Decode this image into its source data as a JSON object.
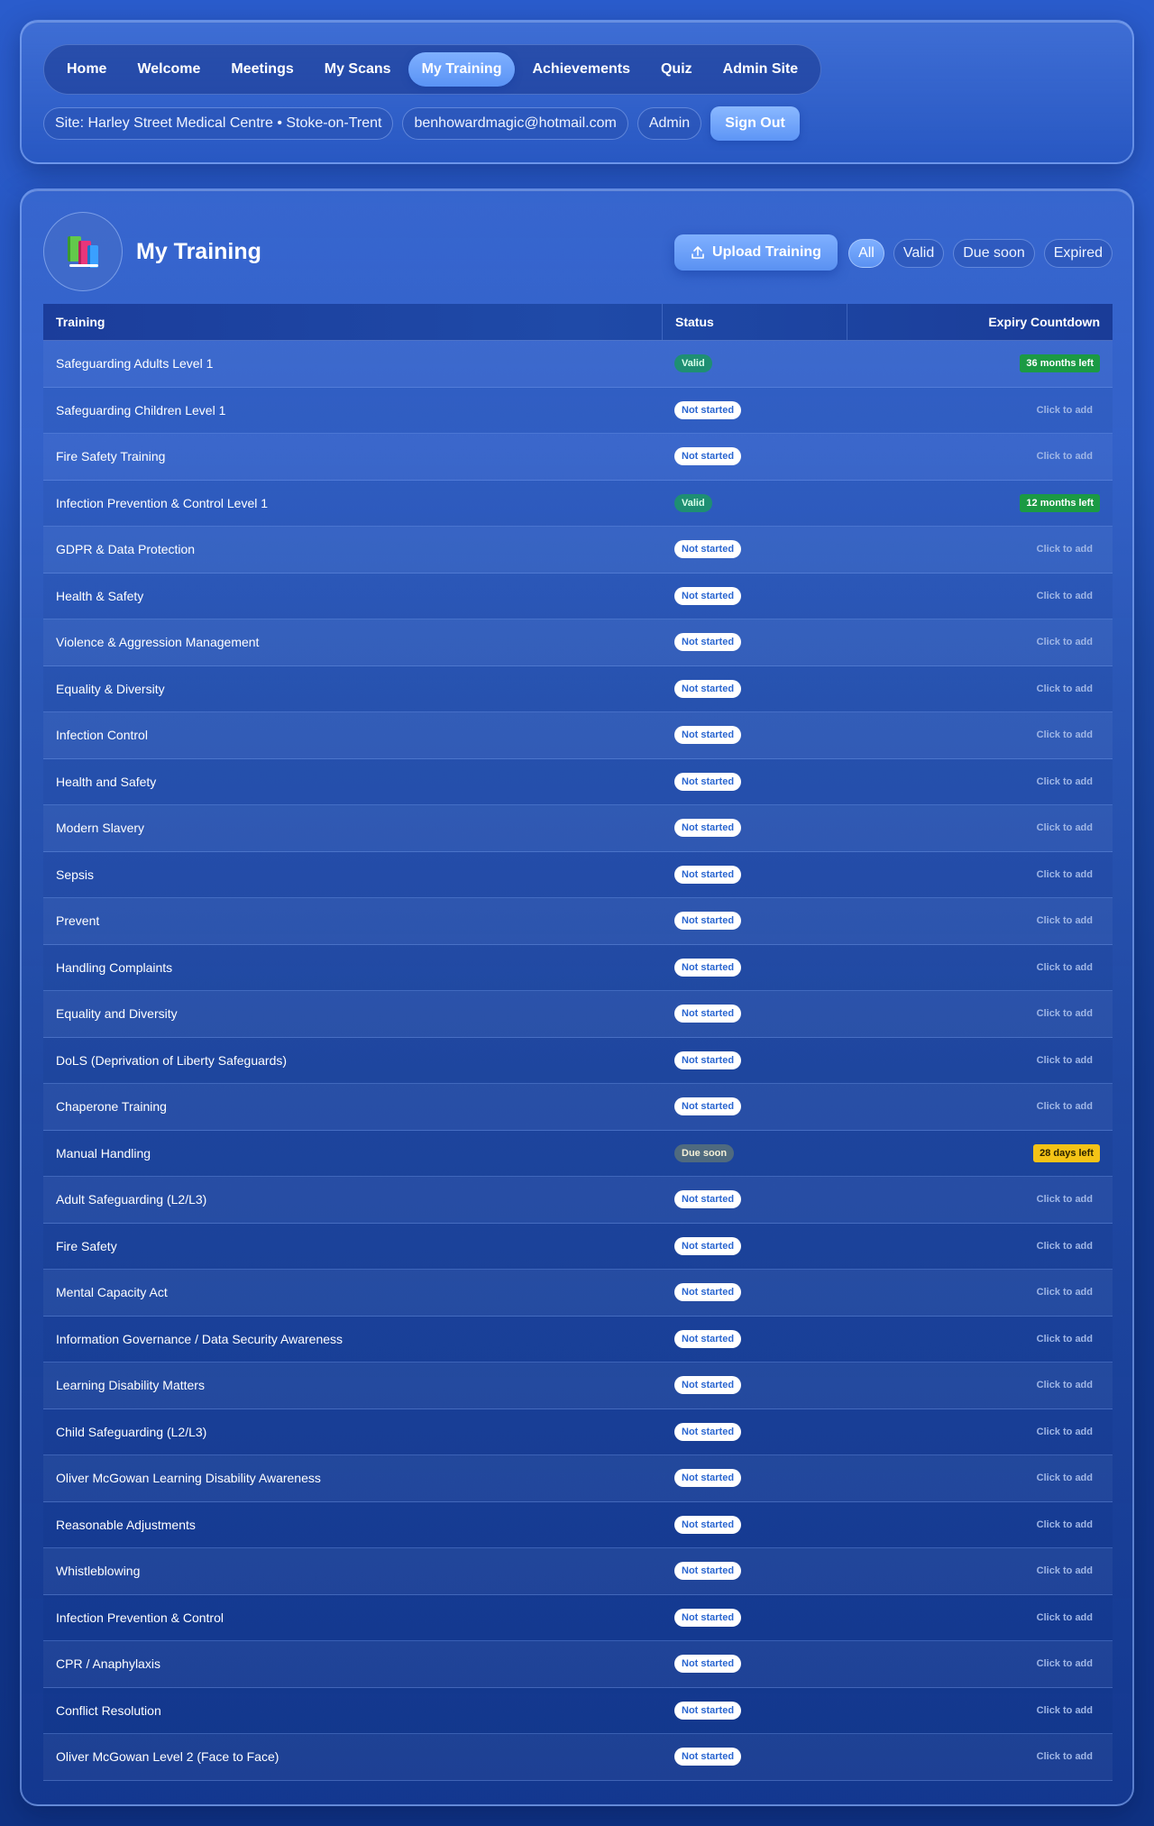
{
  "nav": {
    "items": [
      {
        "label": "Home",
        "active": false
      },
      {
        "label": "Welcome",
        "active": false
      },
      {
        "label": "Meetings",
        "active": false
      },
      {
        "label": "My Scans",
        "active": false
      },
      {
        "label": "My Training",
        "active": true
      },
      {
        "label": "Achievements",
        "active": false
      },
      {
        "label": "Quiz",
        "active": false
      },
      {
        "label": "Admin Site",
        "active": false
      }
    ]
  },
  "infobar": {
    "site": "Site: Harley Street Medical Centre • Stoke-on-Trent",
    "email": "benhowardmagic@hotmail.com",
    "role": "Admin",
    "signout_label": "Sign Out"
  },
  "header": {
    "icon": "books-icon",
    "title": "My Training",
    "upload_label": "Upload Training",
    "upload_icon": "upload-icon",
    "filters": [
      {
        "label": "All",
        "active": true
      },
      {
        "label": "Valid",
        "active": false
      },
      {
        "label": "Due soon",
        "active": false
      },
      {
        "label": "Expired",
        "active": false
      }
    ]
  },
  "table": {
    "columns": [
      "Training",
      "Status",
      "Expiry Countdown"
    ],
    "rows": [
      {
        "training": "Safeguarding Adults Level 1",
        "status": "Valid",
        "status_kind": "valid",
        "expiry": "36 months left",
        "expiry_kind": "green"
      },
      {
        "training": "Safeguarding Children Level 1",
        "status": "Not started",
        "status_kind": "not-started",
        "expiry": "Click to add",
        "expiry_kind": "add"
      },
      {
        "training": "Fire Safety Training",
        "status": "Not started",
        "status_kind": "not-started",
        "expiry": "Click to add",
        "expiry_kind": "add"
      },
      {
        "training": "Infection Prevention & Control Level 1",
        "status": "Valid",
        "status_kind": "valid",
        "expiry": "12 months left",
        "expiry_kind": "green"
      },
      {
        "training": "GDPR & Data Protection",
        "status": "Not started",
        "status_kind": "not-started",
        "expiry": "Click to add",
        "expiry_kind": "add"
      },
      {
        "training": "Health & Safety",
        "status": "Not started",
        "status_kind": "not-started",
        "expiry": "Click to add",
        "expiry_kind": "add"
      },
      {
        "training": "Violence & Aggression Management",
        "status": "Not started",
        "status_kind": "not-started",
        "expiry": "Click to add",
        "expiry_kind": "add"
      },
      {
        "training": "Equality & Diversity",
        "status": "Not started",
        "status_kind": "not-started",
        "expiry": "Click to add",
        "expiry_kind": "add"
      },
      {
        "training": "Infection Control",
        "status": "Not started",
        "status_kind": "not-started",
        "expiry": "Click to add",
        "expiry_kind": "add"
      },
      {
        "training": "Health and Safety",
        "status": "Not started",
        "status_kind": "not-started",
        "expiry": "Click to add",
        "expiry_kind": "add"
      },
      {
        "training": "Modern Slavery",
        "status": "Not started",
        "status_kind": "not-started",
        "expiry": "Click to add",
        "expiry_kind": "add"
      },
      {
        "training": "Sepsis",
        "status": "Not started",
        "status_kind": "not-started",
        "expiry": "Click to add",
        "expiry_kind": "add"
      },
      {
        "training": "Prevent",
        "status": "Not started",
        "status_kind": "not-started",
        "expiry": "Click to add",
        "expiry_kind": "add"
      },
      {
        "training": "Handling Complaints",
        "status": "Not started",
        "status_kind": "not-started",
        "expiry": "Click to add",
        "expiry_kind": "add"
      },
      {
        "training": "Equality and Diversity",
        "status": "Not started",
        "status_kind": "not-started",
        "expiry": "Click to add",
        "expiry_kind": "add"
      },
      {
        "training": "DoLS (Deprivation of Liberty Safeguards)",
        "status": "Not started",
        "status_kind": "not-started",
        "expiry": "Click to add",
        "expiry_kind": "add"
      },
      {
        "training": "Chaperone Training",
        "status": "Not started",
        "status_kind": "not-started",
        "expiry": "Click to add",
        "expiry_kind": "add"
      },
      {
        "training": "Manual Handling",
        "status": "Due soon",
        "status_kind": "due-soon",
        "expiry": "28 days left",
        "expiry_kind": "yellow"
      },
      {
        "training": "Adult Safeguarding (L2/L3)",
        "status": "Not started",
        "status_kind": "not-started",
        "expiry": "Click to add",
        "expiry_kind": "add"
      },
      {
        "training": "Fire Safety",
        "status": "Not started",
        "status_kind": "not-started",
        "expiry": "Click to add",
        "expiry_kind": "add"
      },
      {
        "training": "Mental Capacity Act",
        "status": "Not started",
        "status_kind": "not-started",
        "expiry": "Click to add",
        "expiry_kind": "add"
      },
      {
        "training": "Information Governance / Data Security Awareness",
        "status": "Not started",
        "status_kind": "not-started",
        "expiry": "Click to add",
        "expiry_kind": "add"
      },
      {
        "training": "Learning Disability Matters",
        "status": "Not started",
        "status_kind": "not-started",
        "expiry": "Click to add",
        "expiry_kind": "add"
      },
      {
        "training": "Child Safeguarding (L2/L3)",
        "status": "Not started",
        "status_kind": "not-started",
        "expiry": "Click to add",
        "expiry_kind": "add"
      },
      {
        "training": "Oliver McGowan Learning Disability Awareness",
        "status": "Not started",
        "status_kind": "not-started",
        "expiry": "Click to add",
        "expiry_kind": "add"
      },
      {
        "training": "Reasonable Adjustments",
        "status": "Not started",
        "status_kind": "not-started",
        "expiry": "Click to add",
        "expiry_kind": "add"
      },
      {
        "training": "Whistleblowing",
        "status": "Not started",
        "status_kind": "not-started",
        "expiry": "Click to add",
        "expiry_kind": "add"
      },
      {
        "training": "Infection Prevention & Control",
        "status": "Not started",
        "status_kind": "not-started",
        "expiry": "Click to add",
        "expiry_kind": "add"
      },
      {
        "training": "CPR / Anaphylaxis",
        "status": "Not started",
        "status_kind": "not-started",
        "expiry": "Click to add",
        "expiry_kind": "add"
      },
      {
        "training": "Conflict Resolution",
        "status": "Not started",
        "status_kind": "not-started",
        "expiry": "Click to add",
        "expiry_kind": "add"
      },
      {
        "training": "Oliver McGowan Level 2 (Face to Face)",
        "status": "Not started",
        "status_kind": "not-started",
        "expiry": "Click to add",
        "expiry_kind": "add"
      }
    ]
  },
  "colors": {
    "accent": "#5a93f5",
    "valid": "#1e8f73",
    "countdown_green": "#1b9a44",
    "countdown_yellow": "#f4c316",
    "due_soon": "#4f6a7f"
  }
}
